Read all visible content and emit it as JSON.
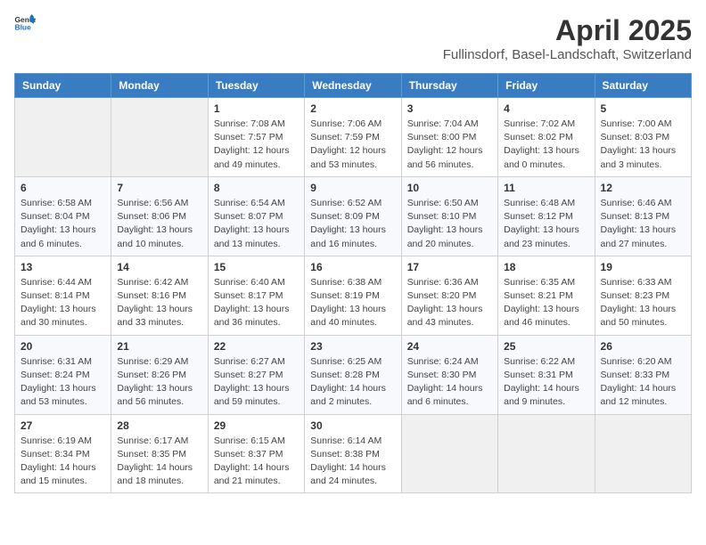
{
  "header": {
    "logo_general": "General",
    "logo_blue": "Blue",
    "title": "April 2025",
    "subtitle": "Fullinsdorf, Basel-Landschaft, Switzerland"
  },
  "calendar": {
    "days_of_week": [
      "Sunday",
      "Monday",
      "Tuesday",
      "Wednesday",
      "Thursday",
      "Friday",
      "Saturday"
    ],
    "weeks": [
      [
        {
          "day": "",
          "info": ""
        },
        {
          "day": "",
          "info": ""
        },
        {
          "day": "1",
          "info": "Sunrise: 7:08 AM\nSunset: 7:57 PM\nDaylight: 12 hours and 49 minutes."
        },
        {
          "day": "2",
          "info": "Sunrise: 7:06 AM\nSunset: 7:59 PM\nDaylight: 12 hours and 53 minutes."
        },
        {
          "day": "3",
          "info": "Sunrise: 7:04 AM\nSunset: 8:00 PM\nDaylight: 12 hours and 56 minutes."
        },
        {
          "day": "4",
          "info": "Sunrise: 7:02 AM\nSunset: 8:02 PM\nDaylight: 13 hours and 0 minutes."
        },
        {
          "day": "5",
          "info": "Sunrise: 7:00 AM\nSunset: 8:03 PM\nDaylight: 13 hours and 3 minutes."
        }
      ],
      [
        {
          "day": "6",
          "info": "Sunrise: 6:58 AM\nSunset: 8:04 PM\nDaylight: 13 hours and 6 minutes."
        },
        {
          "day": "7",
          "info": "Sunrise: 6:56 AM\nSunset: 8:06 PM\nDaylight: 13 hours and 10 minutes."
        },
        {
          "day": "8",
          "info": "Sunrise: 6:54 AM\nSunset: 8:07 PM\nDaylight: 13 hours and 13 minutes."
        },
        {
          "day": "9",
          "info": "Sunrise: 6:52 AM\nSunset: 8:09 PM\nDaylight: 13 hours and 16 minutes."
        },
        {
          "day": "10",
          "info": "Sunrise: 6:50 AM\nSunset: 8:10 PM\nDaylight: 13 hours and 20 minutes."
        },
        {
          "day": "11",
          "info": "Sunrise: 6:48 AM\nSunset: 8:12 PM\nDaylight: 13 hours and 23 minutes."
        },
        {
          "day": "12",
          "info": "Sunrise: 6:46 AM\nSunset: 8:13 PM\nDaylight: 13 hours and 27 minutes."
        }
      ],
      [
        {
          "day": "13",
          "info": "Sunrise: 6:44 AM\nSunset: 8:14 PM\nDaylight: 13 hours and 30 minutes."
        },
        {
          "day": "14",
          "info": "Sunrise: 6:42 AM\nSunset: 8:16 PM\nDaylight: 13 hours and 33 minutes."
        },
        {
          "day": "15",
          "info": "Sunrise: 6:40 AM\nSunset: 8:17 PM\nDaylight: 13 hours and 36 minutes."
        },
        {
          "day": "16",
          "info": "Sunrise: 6:38 AM\nSunset: 8:19 PM\nDaylight: 13 hours and 40 minutes."
        },
        {
          "day": "17",
          "info": "Sunrise: 6:36 AM\nSunset: 8:20 PM\nDaylight: 13 hours and 43 minutes."
        },
        {
          "day": "18",
          "info": "Sunrise: 6:35 AM\nSunset: 8:21 PM\nDaylight: 13 hours and 46 minutes."
        },
        {
          "day": "19",
          "info": "Sunrise: 6:33 AM\nSunset: 8:23 PM\nDaylight: 13 hours and 50 minutes."
        }
      ],
      [
        {
          "day": "20",
          "info": "Sunrise: 6:31 AM\nSunset: 8:24 PM\nDaylight: 13 hours and 53 minutes."
        },
        {
          "day": "21",
          "info": "Sunrise: 6:29 AM\nSunset: 8:26 PM\nDaylight: 13 hours and 56 minutes."
        },
        {
          "day": "22",
          "info": "Sunrise: 6:27 AM\nSunset: 8:27 PM\nDaylight: 13 hours and 59 minutes."
        },
        {
          "day": "23",
          "info": "Sunrise: 6:25 AM\nSunset: 8:28 PM\nDaylight: 14 hours and 2 minutes."
        },
        {
          "day": "24",
          "info": "Sunrise: 6:24 AM\nSunset: 8:30 PM\nDaylight: 14 hours and 6 minutes."
        },
        {
          "day": "25",
          "info": "Sunrise: 6:22 AM\nSunset: 8:31 PM\nDaylight: 14 hours and 9 minutes."
        },
        {
          "day": "26",
          "info": "Sunrise: 6:20 AM\nSunset: 8:33 PM\nDaylight: 14 hours and 12 minutes."
        }
      ],
      [
        {
          "day": "27",
          "info": "Sunrise: 6:19 AM\nSunset: 8:34 PM\nDaylight: 14 hours and 15 minutes."
        },
        {
          "day": "28",
          "info": "Sunrise: 6:17 AM\nSunset: 8:35 PM\nDaylight: 14 hours and 18 minutes."
        },
        {
          "day": "29",
          "info": "Sunrise: 6:15 AM\nSunset: 8:37 PM\nDaylight: 14 hours and 21 minutes."
        },
        {
          "day": "30",
          "info": "Sunrise: 6:14 AM\nSunset: 8:38 PM\nDaylight: 14 hours and 24 minutes."
        },
        {
          "day": "",
          "info": ""
        },
        {
          "day": "",
          "info": ""
        },
        {
          "day": "",
          "info": ""
        }
      ]
    ]
  }
}
